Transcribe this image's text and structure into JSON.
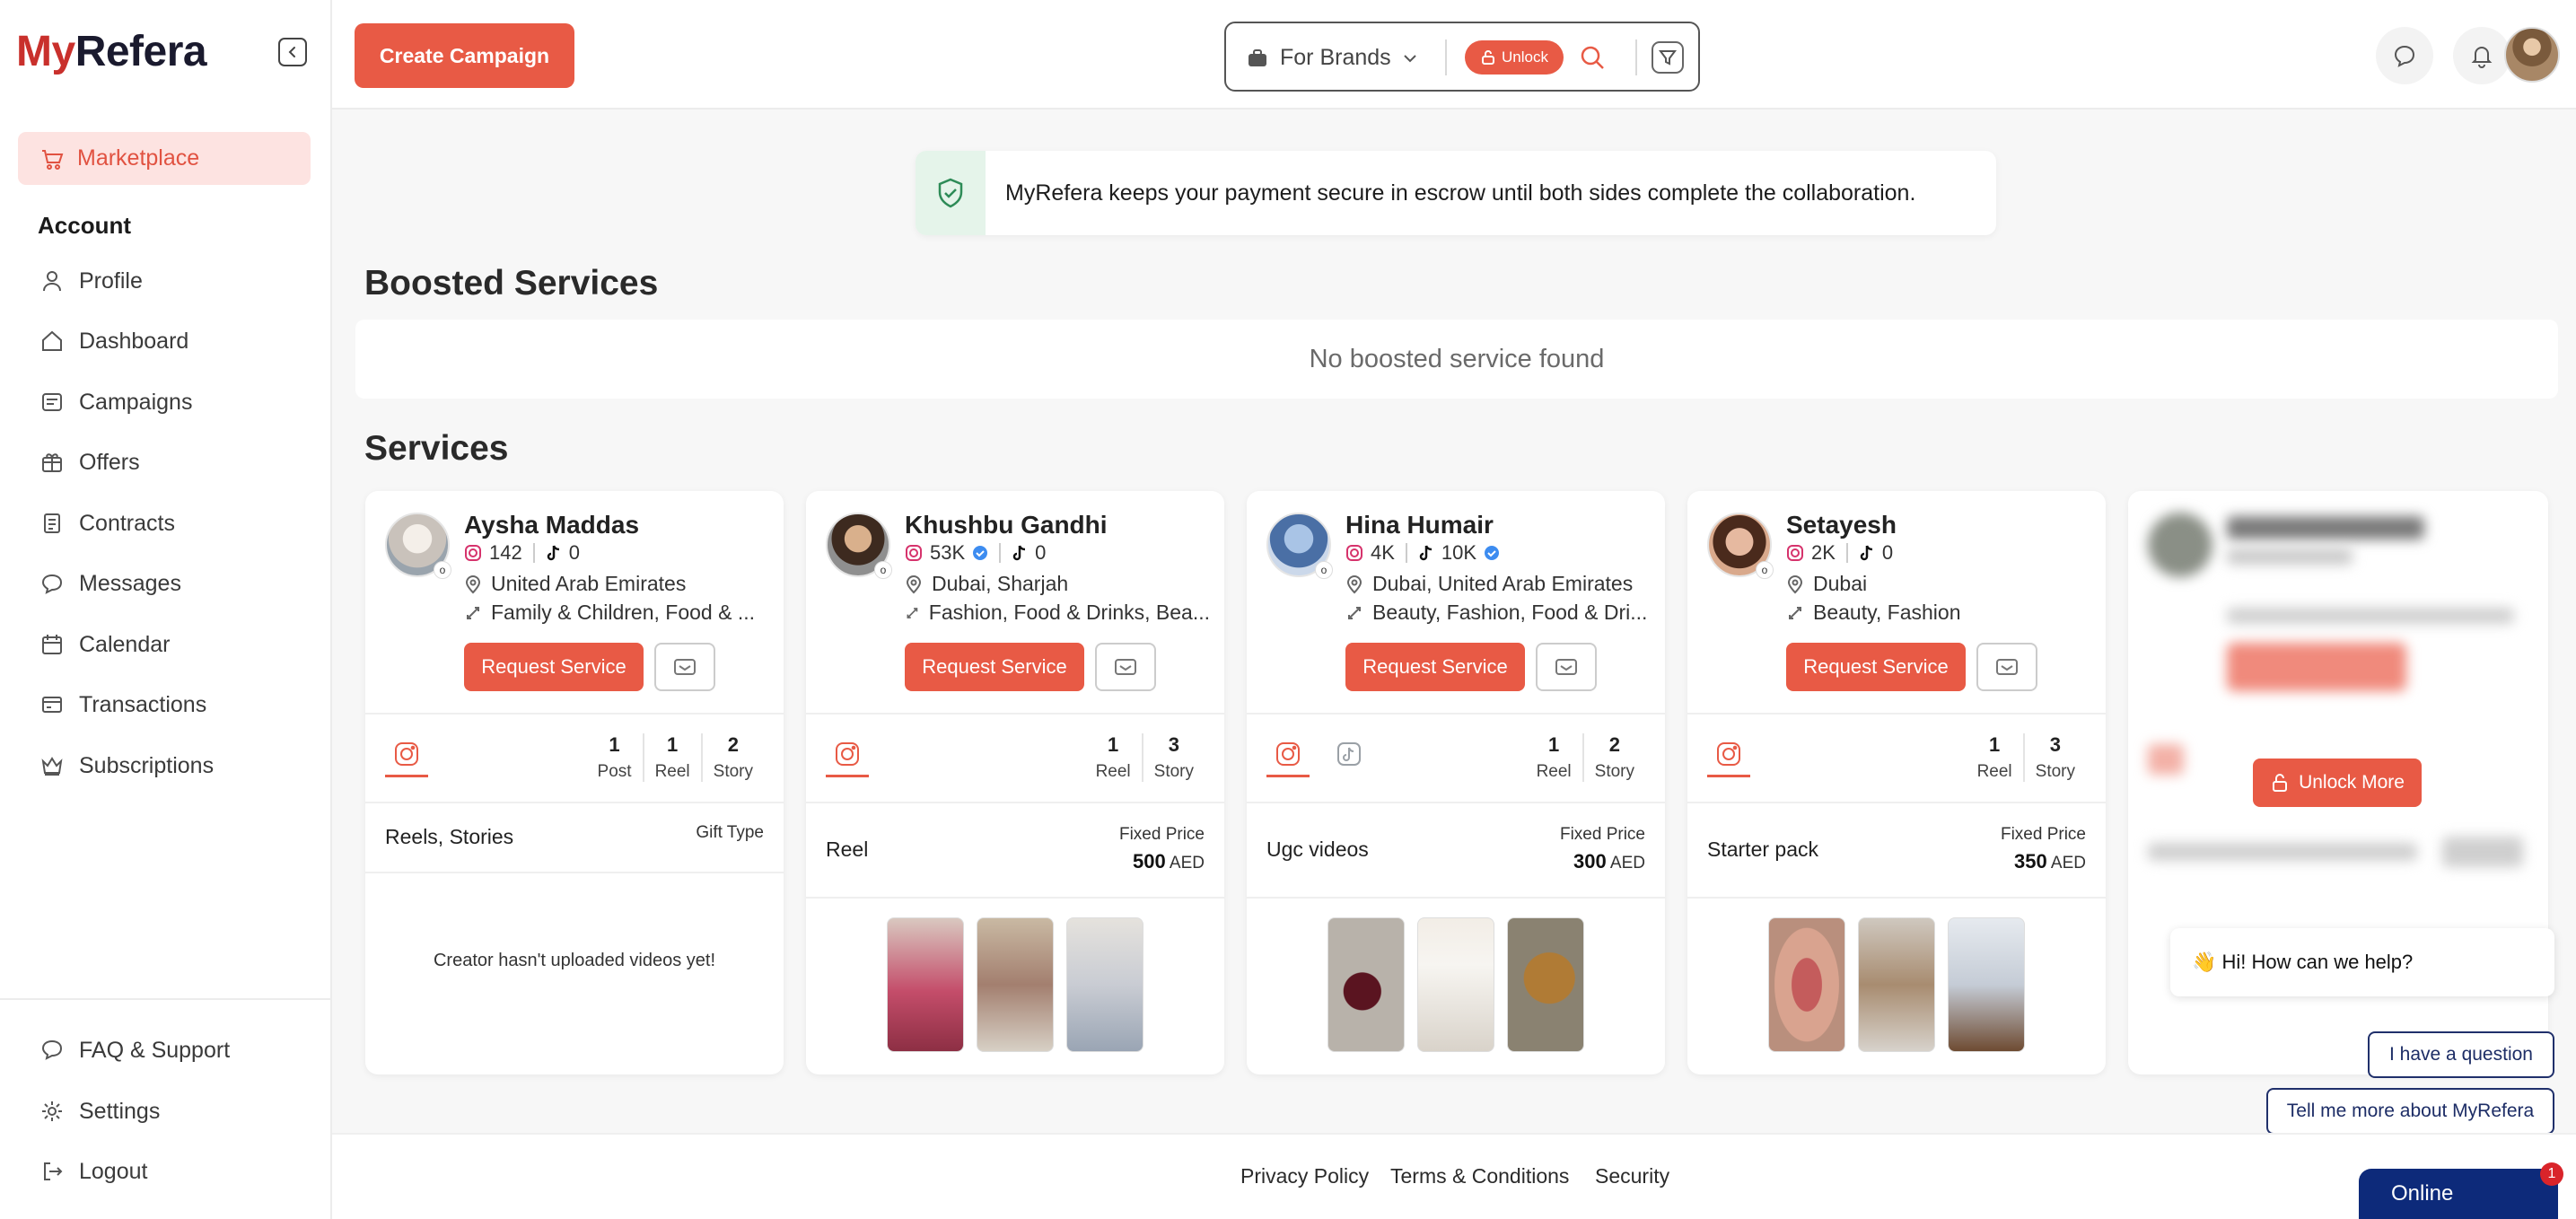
{
  "brand": {
    "logo_m": "My",
    "logo_rest": "Refera"
  },
  "sidebar": {
    "active_item": {
      "label": "Marketplace",
      "icon": "cart-icon"
    },
    "account_title": "Account",
    "items": [
      {
        "label": "Profile",
        "icon": "user-icon"
      },
      {
        "label": "Dashboard",
        "icon": "home-icon"
      },
      {
        "label": "Campaigns",
        "icon": "campaign-icon"
      },
      {
        "label": "Offers",
        "icon": "offer-icon"
      },
      {
        "label": "Contracts",
        "icon": "contract-icon"
      },
      {
        "label": "Messages",
        "icon": "message-icon"
      },
      {
        "label": "Calendar",
        "icon": "calendar-icon"
      },
      {
        "label": "Transactions",
        "icon": "transaction-icon"
      },
      {
        "label": "Subscriptions",
        "icon": "crown-icon"
      }
    ],
    "bottom_items": [
      {
        "label": "FAQ & Support",
        "icon": "help-icon"
      },
      {
        "label": "Settings",
        "icon": "gear-icon"
      },
      {
        "label": "Logout",
        "icon": "logout-icon"
      }
    ]
  },
  "header": {
    "create_campaign": "Create Campaign",
    "search": {
      "brand_filter": "For Brands",
      "unlock_label": "Unlock"
    }
  },
  "escrow_notice": "MyRefera keeps your payment secure in escrow until both sides complete the collaboration.",
  "boosted": {
    "title": "Boosted Services",
    "empty": "No boosted service found"
  },
  "services": {
    "title": "Services",
    "request_label": "Request Service",
    "fixed_price_label": "Fixed Price",
    "currency": "AED",
    "cards": [
      {
        "name": "Aysha Maddas",
        "instagram": "142",
        "tiktok": "0",
        "location": "United Arab Emirates",
        "categories": "Family & Children, Food & ...",
        "counts": [
          {
            "n": "1",
            "label": "Post"
          },
          {
            "n": "1",
            "label": "Reel"
          },
          {
            "n": "2",
            "label": "Story"
          }
        ],
        "package": "Reels, Stories",
        "price_label": "Gift Type",
        "price": "",
        "empty_videos": "Creator hasn't uploaded videos yet!"
      },
      {
        "name": "Khushbu Gandhi",
        "instagram": "53K",
        "tiktok": "0",
        "location": "Dubai, Sharjah",
        "categories": "Fashion, Food & Drinks, Bea...",
        "counts": [
          {
            "n": "1",
            "label": "Reel"
          },
          {
            "n": "3",
            "label": "Story"
          }
        ],
        "package": "Reel",
        "price_label": "Fixed Price",
        "price": "500"
      },
      {
        "name": "Hina Humair",
        "instagram": "4K",
        "tiktok": "10K",
        "location": "Dubai, United Arab Emirates",
        "categories": "Beauty, Fashion, Food & Dri...",
        "counts": [
          {
            "n": "1",
            "label": "Reel"
          },
          {
            "n": "2",
            "label": "Story"
          }
        ],
        "package": "Ugc videos",
        "price_label": "Fixed Price",
        "price": "300"
      },
      {
        "name": "Setayesh",
        "instagram": "2K",
        "tiktok": "0",
        "location": "Dubai",
        "categories": "Beauty, Fashion",
        "counts": [
          {
            "n": "1",
            "label": "Reel"
          },
          {
            "n": "3",
            "label": "Story"
          }
        ],
        "package": "Starter pack",
        "price_label": "Fixed Price",
        "price": "350"
      }
    ],
    "unlock_more": "Unlock More"
  },
  "chat": {
    "greeting": "👋 Hi! How can we help?",
    "question_btn": "I have a question",
    "tell_more_btn": "Tell me more about MyRefera",
    "online": "Online",
    "badge": "1"
  },
  "footer": {
    "links": [
      "Privacy Policy",
      "Terms & Conditions",
      "Security"
    ]
  },
  "colors": {
    "accent": "#e85a45",
    "active_bg": "#fde3e1",
    "online_bg": "#0d2a7a"
  }
}
